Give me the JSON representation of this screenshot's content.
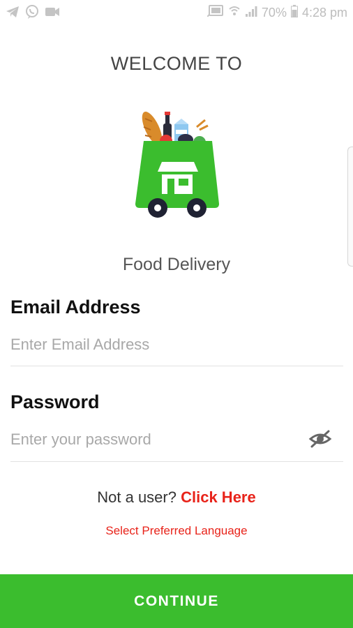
{
  "status_bar": {
    "battery_percent": "70%",
    "time": "4:28 pm",
    "icons": [
      "telegram-icon",
      "viber-icon",
      "video-icon",
      "cast-icon",
      "wifi-icon",
      "signal-icon",
      "battery-icon"
    ]
  },
  "header": {
    "welcome": "WELCOME TO",
    "app_name": "Food Delivery"
  },
  "form": {
    "email": {
      "label": "Email Address",
      "placeholder": "Enter Email Address",
      "value": ""
    },
    "password": {
      "label": "Password",
      "placeholder": "Enter your password",
      "value": ""
    }
  },
  "signup": {
    "prompt": "Not a user?",
    "link": "Click Here"
  },
  "language_link": "Select Preferred Language",
  "continue_label": "CONTINUE",
  "colors": {
    "accent_green": "#3bbd2e",
    "link_red": "#e8231a"
  }
}
